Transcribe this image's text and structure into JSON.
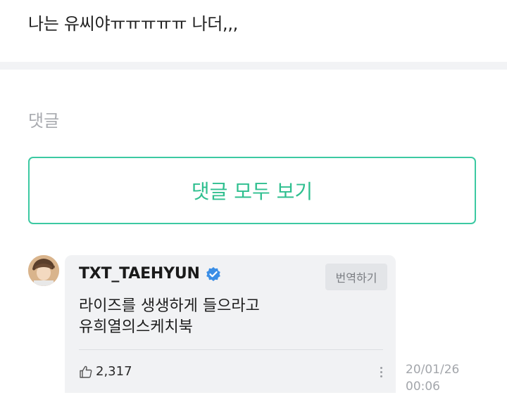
{
  "post": {
    "text": "나는 유씨야ㅠㅠㅠㅠㅠ 나더,,,"
  },
  "comments_section": {
    "label": "댓글",
    "view_all_label": "댓글 모두 보기"
  },
  "comment": {
    "author": "TXT_TAEHYUN",
    "verified_icon": "verified-badge-icon",
    "translate_label": "번역하기",
    "body_line1": "라이즈를 생생하게 들으라고",
    "body_line2": "유희열의스케치북",
    "likes": "2,317",
    "like_icon": "thumbs-up-icon",
    "more_icon": "more-vertical-icon",
    "date": "20/01/26",
    "time": "00:06"
  },
  "colors": {
    "accent": "#2fbf8f",
    "verified": "#3a8ee6",
    "muted": "#a9abb0"
  }
}
